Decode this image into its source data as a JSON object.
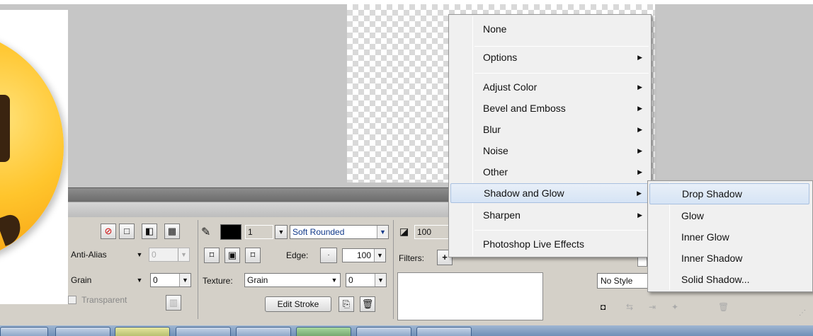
{
  "context_menu": {
    "items": [
      {
        "label": "None",
        "has_submenu": false
      },
      {
        "label": "Options",
        "has_submenu": true
      },
      {
        "label": "Adjust Color",
        "has_submenu": true
      },
      {
        "label": "Bevel and Emboss",
        "has_submenu": true
      },
      {
        "label": "Blur",
        "has_submenu": true
      },
      {
        "label": "Noise",
        "has_submenu": true
      },
      {
        "label": "Other",
        "has_submenu": true
      },
      {
        "label": "Shadow and Glow",
        "has_submenu": true,
        "highlighted": true
      },
      {
        "label": "Sharpen",
        "has_submenu": true
      },
      {
        "label": "Photoshop Live Effects",
        "has_submenu": false
      }
    ],
    "submenu_arrow": "▶"
  },
  "submenu": {
    "items": [
      {
        "label": "Drop Shadow",
        "highlighted": true
      },
      {
        "label": "Glow"
      },
      {
        "label": "Inner Glow"
      },
      {
        "label": "Inner Shadow"
      },
      {
        "label": "Solid Shadow..."
      }
    ]
  },
  "properties": {
    "anti_alias": "Anti-Alias",
    "anti_alias_value": "0",
    "grain_left": "Grain",
    "grain_left_value": "0",
    "transparent_label": "Transparent",
    "stroke_size": "1",
    "stroke_type": "Soft Rounded",
    "edge_label": "Edge:",
    "edge_value": "100",
    "texture_label": "Texture:",
    "texture_value": "Grain",
    "texture_amount": "0",
    "edit_stroke": "Edit Stroke",
    "opacity_value": "100",
    "filters_label": "Filters:",
    "filters_add": "+",
    "style_value": "No Style",
    "dropdown_arrow": "▼"
  },
  "colors": {
    "menu_bg": "#f0f0f0",
    "menu_highlight": "#d6e4f5",
    "panel_bg": "#d4d0c8"
  }
}
